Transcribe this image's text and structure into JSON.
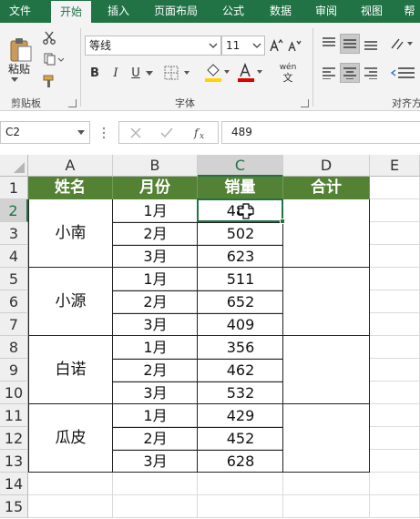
{
  "ribbon_tabs": [
    "文件",
    "开始",
    "插入",
    "页面布局",
    "公式",
    "数据",
    "审阅",
    "视图",
    "帮"
  ],
  "active_tab_index": 1,
  "ribbon": {
    "paste_label": "粘贴",
    "clipboard_group": "剪贴板",
    "font_group": "字体",
    "alignment_group": "对齐方",
    "font_name": "等线",
    "font_size": "11",
    "bold": "B",
    "italic": "I",
    "underline": "U",
    "wen_top": "wén",
    "wen_bottom": "文"
  },
  "formula_bar": {
    "name_box": "C2",
    "formula_value": "489"
  },
  "sheet": {
    "columns": [
      "A",
      "B",
      "C",
      "D",
      "E"
    ],
    "selected_column": "C",
    "rows": [
      "1",
      "2",
      "3",
      "4",
      "5",
      "6",
      "7",
      "8",
      "9",
      "10",
      "11",
      "12",
      "13",
      "14",
      "15"
    ],
    "selected_row": "2",
    "header": [
      "姓名",
      "月份",
      "销量",
      "合计"
    ],
    "groups": [
      {
        "name": "小南",
        "months": [
          "1月",
          "2月",
          "3月"
        ],
        "sales": [
          "489",
          "502",
          "623"
        ]
      },
      {
        "name": "小源",
        "months": [
          "1月",
          "2月",
          "3月"
        ],
        "sales": [
          "511",
          "652",
          "409"
        ]
      },
      {
        "name": "白诺",
        "months": [
          "1月",
          "2月",
          "3月"
        ],
        "sales": [
          "356",
          "462",
          "532"
        ]
      },
      {
        "name": "瓜皮",
        "months": [
          "1月",
          "2月",
          "3月"
        ],
        "sales": [
          "429",
          "452",
          "628"
        ]
      }
    ]
  },
  "colors": {
    "excel_green": "#217346",
    "header_fill": "#548235",
    "header_text": "#ffffff"
  }
}
